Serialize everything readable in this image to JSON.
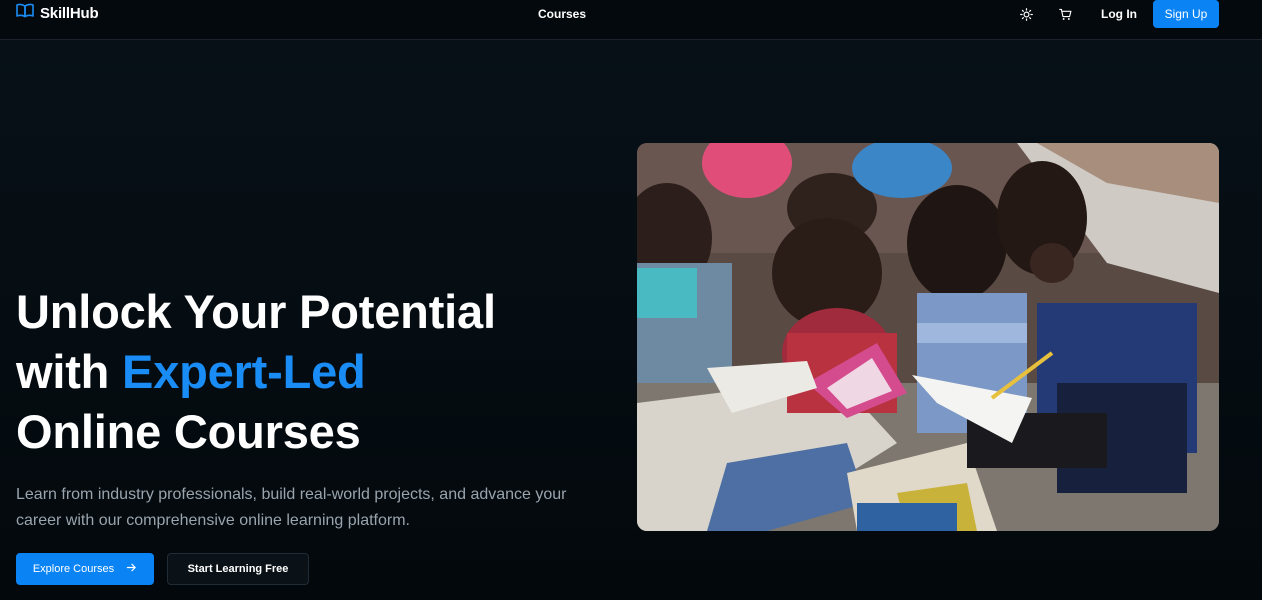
{
  "nav": {
    "brand": "SkillHub",
    "links": [
      "Courses"
    ],
    "login_label": "Log In",
    "signup_label": "Sign Up",
    "icons": [
      "book-icon",
      "sun-icon",
      "cart-icon"
    ]
  },
  "hero": {
    "title_line1": "Unlock Your Potential",
    "title_line2_prefix": "with ",
    "title_line2_accent": "Expert-Led",
    "title_line3": "Online Courses",
    "subtitle": "Learn from industry professionals, build real-world projects, and advance your career with our comprehensive online learning platform.",
    "primary_cta": "Explore Courses",
    "secondary_cta": "Start Learning Free"
  },
  "colors": {
    "accent": "#0a84f5",
    "background": "#050d12"
  }
}
